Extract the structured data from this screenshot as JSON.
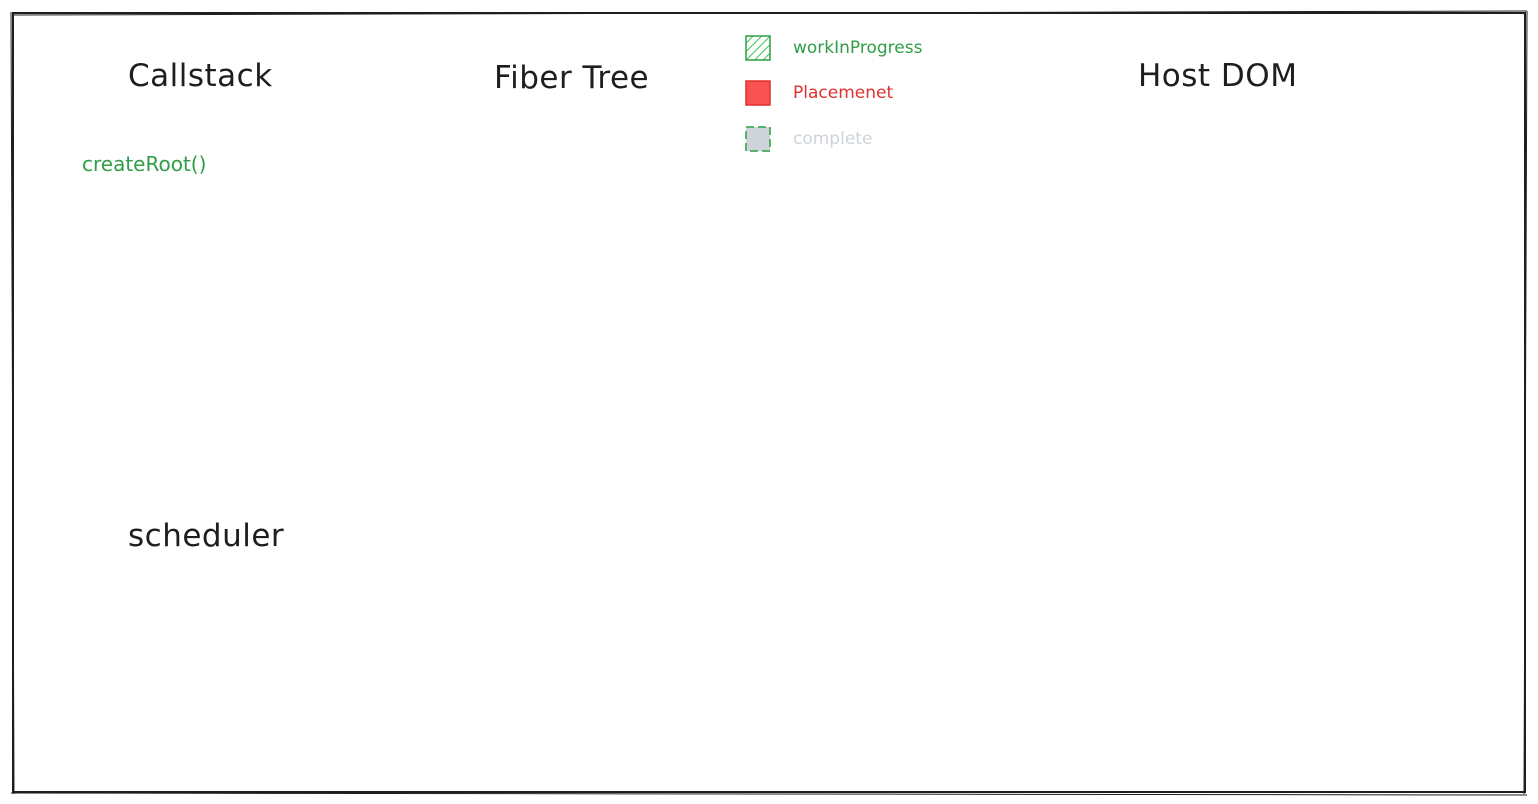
{
  "headings": {
    "callstack": "Callstack",
    "fiber_tree": "Fiber Tree",
    "host_dom": "Host DOM",
    "scheduler": "scheduler"
  },
  "callstack": {
    "items": [
      "createRoot()"
    ]
  },
  "legend": [
    {
      "label": "workInProgress",
      "color": "#2f9e44",
      "fill": "hatched-green"
    },
    {
      "label": "Placemenet",
      "color": "#e03131",
      "fill": "solid-red"
    },
    {
      "label": "complete",
      "color": "#ced4da",
      "fill": "solid-gray"
    }
  ]
}
